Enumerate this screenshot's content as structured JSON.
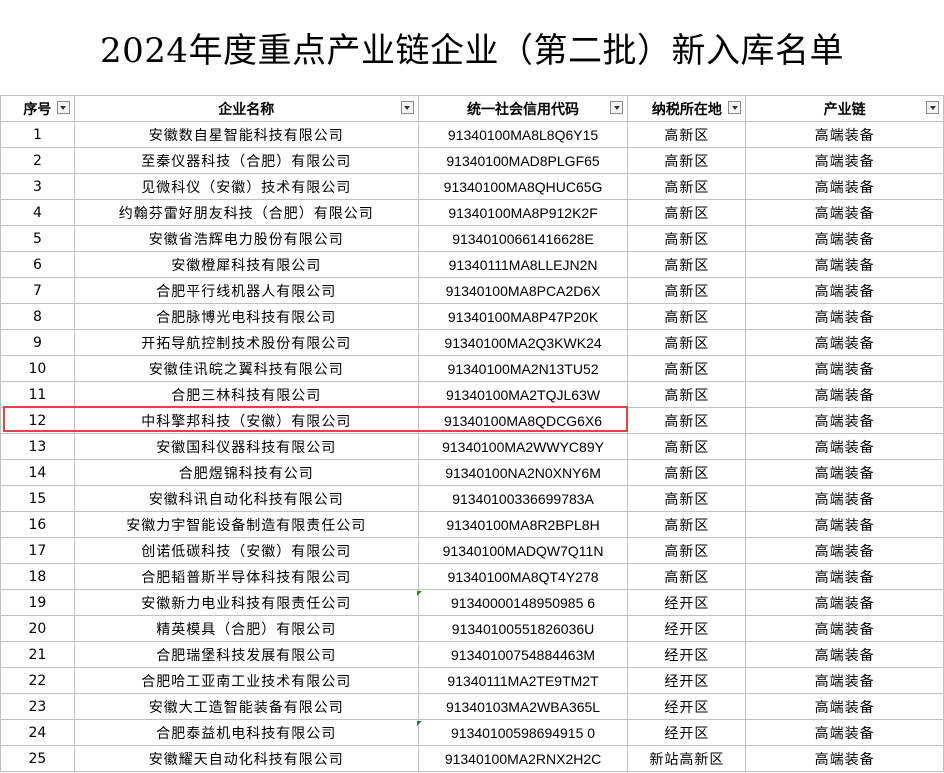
{
  "title": "2024年度重点产业链企业（第二批）新入库名单",
  "columns": [
    "序号",
    "企业名称",
    "统一社会信用代码",
    "纳税所在地",
    "产业链"
  ],
  "rows": [
    [
      "1",
      "安徽数自星智能科技有限公司",
      "91340100MA8L8Q6Y15",
      "高新区",
      "高端装备"
    ],
    [
      "2",
      "至秦仪器科技（合肥）有限公司",
      "91340100MAD8PLGF65",
      "高新区",
      "高端装备"
    ],
    [
      "3",
      "见微科仪（安徽）技术有限公司",
      "91340100MA8QHUC65G",
      "高新区",
      "高端装备"
    ],
    [
      "4",
      "约翰芬雷好朋友科技（合肥）有限公司",
      "91340100MA8P912K2F",
      "高新区",
      "高端装备"
    ],
    [
      "5",
      "安徽省浩辉电力股份有限公司",
      "91340100661416628E",
      "高新区",
      "高端装备"
    ],
    [
      "6",
      "安徽橙犀科技有限公司",
      "91340111MA8LLEJN2N",
      "高新区",
      "高端装备"
    ],
    [
      "7",
      "合肥平行线机器人有限公司",
      "91340100MA8PCA2D6X",
      "高新区",
      "高端装备"
    ],
    [
      "8",
      "合肥脉博光电科技有限公司",
      "91340100MA8P47P20K",
      "高新区",
      "高端装备"
    ],
    [
      "9",
      "开拓导航控制技术股份有限公司",
      "91340100MA2Q3KWK24",
      "高新区",
      "高端装备"
    ],
    [
      "10",
      "安徽佳讯皖之翼科技有限公司",
      "91340100MA2N13TU52",
      "高新区",
      "高端装备"
    ],
    [
      "11",
      "合肥三林科技有限公司",
      "91340100MA2TQJL63W",
      "高新区",
      "高端装备"
    ],
    [
      "12",
      "中科擎邦科技（安徽）有限公司",
      "91340100MA8QDCG6X6",
      "高新区",
      "高端装备"
    ],
    [
      "13",
      "安徽国科仪器科技有限公司",
      "91340100MA2WWYC89Y",
      "高新区",
      "高端装备"
    ],
    [
      "14",
      "合肥煜锦科技有公司",
      "91340100NA2N0XNY6M",
      "高新区",
      "高端装备"
    ],
    [
      "15",
      "安徽科讯自动化科技有限公司",
      "91340100336699783A",
      "高新区",
      "高端装备"
    ],
    [
      "16",
      "安徽力宇智能设备制造有限责任公司",
      "91340100MA8R2BPL8H",
      "高新区",
      "高端装备"
    ],
    [
      "17",
      "创诺低碳科技（安徽）有限公司",
      "91340100MADQW7Q11N",
      "高新区",
      "高端装备"
    ],
    [
      "18",
      "合肥韬普斯半导体科技有限公司",
      "91340100MA8QT4Y278",
      "高新区",
      "高端装备"
    ],
    [
      "19",
      "安徽新力电业科技有限责任公司",
      "91340000148950985 6",
      "经开区",
      "高端装备"
    ],
    [
      "20",
      "精英模具（合肥）有限公司",
      "91340100551826036U",
      "经开区",
      "高端装备"
    ],
    [
      "21",
      "合肥瑞堡科技发展有限公司",
      "91340100754884463M",
      "经开区",
      "高端装备"
    ],
    [
      "22",
      "合肥哈工亚南工业技术有限公司",
      "91340111MA2TE9TM2T",
      "经开区",
      "高端装备"
    ],
    [
      "23",
      "安徽大工造智能装备有限公司",
      "91340103MA2WBA365L",
      "经开区",
      "高端装备"
    ],
    [
      "24",
      "合肥泰益机电科技有限公司",
      "91340100598694915 0",
      "经开区",
      "高端装备"
    ],
    [
      "25",
      "安徽耀天自动化科技有限公司",
      "91340100MA2RNX2H2C",
      "新站高新区",
      "高端装备"
    ]
  ]
}
